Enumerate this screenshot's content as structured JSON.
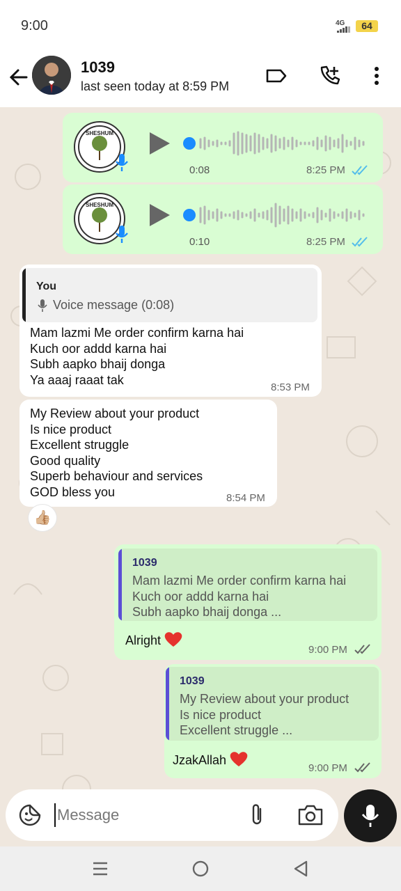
{
  "status_bar": {
    "time": "9:00",
    "network": "4G",
    "battery": "64"
  },
  "header": {
    "contact_name": "1039",
    "last_seen": "last seen today at 8:59 PM"
  },
  "voice_messages": [
    {
      "duration": "0:08",
      "time": "8:25 PM"
    },
    {
      "duration": "0:10",
      "time": "8:25 PM"
    }
  ],
  "incoming_1": {
    "quote_name": "You",
    "quote_text": "Voice message (0:08)",
    "text": "Mam lazmi Me order confirm karna hai\nKuch oor addd karna hai\nSubh aapko bhaij donga\nYa aaaj raaat tak",
    "time": "8:53 PM"
  },
  "incoming_2": {
    "text": "My Review about your product\nIs nice product\nExcellent struggle\nGood quality\nSuperb behaviour and services\nGOD bless you",
    "time": "8:54 PM",
    "reaction": "👍🏼"
  },
  "outgoing_1": {
    "quote_name": "1039",
    "quote_text": "Mam lazmi Me order confirm karna hai\nKuch oor addd karna hai\nSubh aapko bhaij donga ...",
    "text": "Alright",
    "time": "9:00 PM"
  },
  "outgoing_2": {
    "quote_name": "1039",
    "quote_text": "My Review about your product\nIs nice product\nExcellent struggle ...",
    "text": "JzakAllah",
    "time": "9:00 PM"
  },
  "input": {
    "placeholder": "Message"
  },
  "colors": {
    "out_bubble": "#d9fdd3",
    "in_bubble": "#ffffff",
    "read_tick": "#53bdeb",
    "quote_bar": "#5b4fd6",
    "heart": "#e5322d"
  }
}
